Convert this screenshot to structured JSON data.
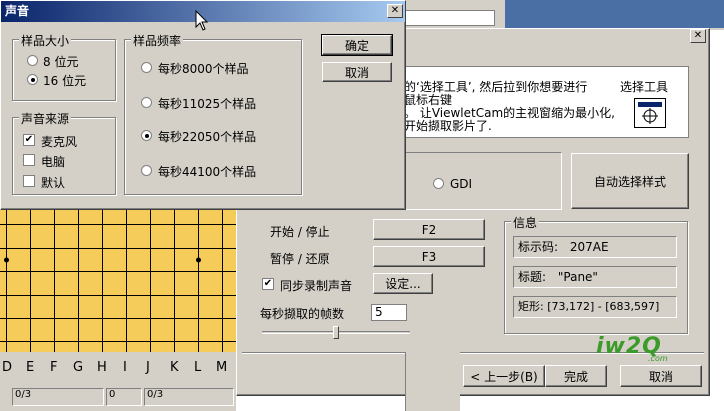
{
  "sound_dialog": {
    "title": "声音",
    "close_label": "✕",
    "sample_size": {
      "title": "样品大小",
      "options": [
        {
          "label": "8 位元",
          "selected": false
        },
        {
          "label": "16 位元",
          "selected": true
        }
      ]
    },
    "sample_rate": {
      "title": "样品频率",
      "options": [
        {
          "label": "每秒8000个样品",
          "selected": false
        },
        {
          "label": "每秒11025个样品",
          "selected": false
        },
        {
          "label": "每秒22050个样品",
          "selected": true
        },
        {
          "label": "每秒44100个样品",
          "selected": false
        }
      ]
    },
    "sound_source": {
      "title": "声音来源",
      "options": [
        {
          "label": "麦克风",
          "checked": true
        },
        {
          "label": "电脑",
          "checked": false
        },
        {
          "label": "默认",
          "checked": false
        }
      ]
    },
    "ok_label": "确定",
    "cancel_label": "取消"
  },
  "wizard": {
    "close_label": "✕",
    "instructions": {
      "line1": "的‘选择工具’, 然后拉到你想要进行",
      "line2": "鼠标右键",
      "line3": "。 让ViewletCam的主视窗缩为最小化,",
      "line4": "开始撷取影片了."
    },
    "select_tool_label": "选择工具",
    "select_tool_icon": "crosshair-target-icon",
    "gdi_label": "GDI",
    "auto_select_label": "自动选择样式",
    "start_stop_label": "开始 / 停止",
    "start_stop_key": "F2",
    "pause_resume_label": "暂停 / 还原",
    "pause_resume_key": "F3",
    "sync_record_label": "同步录制声音",
    "sync_record_checked": true,
    "settings_label": "设定...",
    "fps_label": "每秒撷取的帧数",
    "fps_value": "5",
    "fps_slider_fraction": 0.5,
    "info": {
      "title": "信息",
      "id_label": "标示码:",
      "id_value": "207AE",
      "title_label": "标题:",
      "title_value": "\"Pane\"",
      "rect_label": "矩形:",
      "rect_value": "[73,172] - [683,597]"
    },
    "back_label": "< 上一步(B)",
    "finish_label": "完成",
    "cancel_label": "取消"
  },
  "board": {
    "col_labels": [
      "D",
      "E",
      "F",
      "G",
      "H",
      "I",
      "J",
      "K",
      "L",
      "M"
    ],
    "status_cells": [
      "0/3",
      "0",
      "0/3"
    ]
  },
  "watermark": {
    "text": "iw2Q",
    "subtext": ".com"
  }
}
